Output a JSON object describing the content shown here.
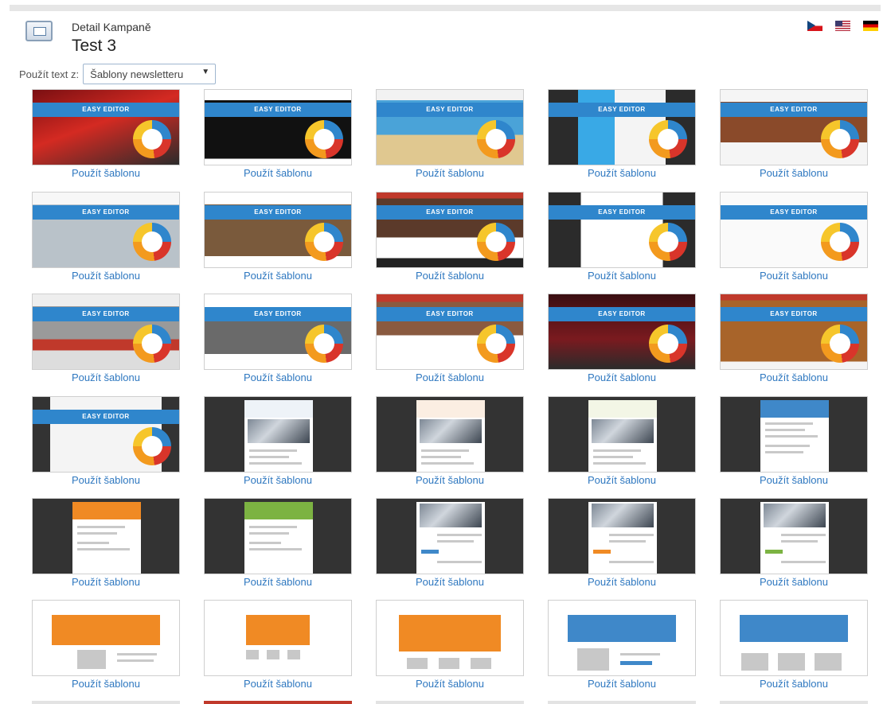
{
  "header": {
    "subtitle": "Detail Kampaně",
    "title": "Test 3"
  },
  "source": {
    "label": "Použít text z:",
    "selected": "Šablony newsletteru"
  },
  "banner_text": "EASY EDITOR",
  "use_template_label": "Použít šablonu",
  "colors": {
    "accent": "#2f86cc",
    "link": "#2f78c0",
    "orange": "#f08a24",
    "green": "#7cb342",
    "dark": "#333333"
  }
}
